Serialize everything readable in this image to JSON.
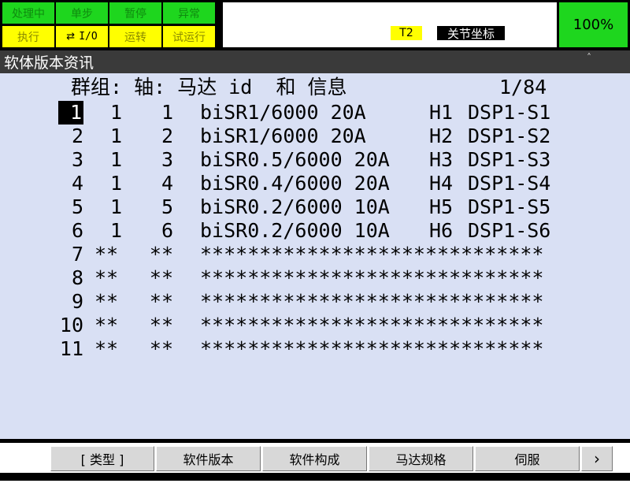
{
  "status_lamps": {
    "row1": [
      "处理中",
      "单步",
      "暂停",
      "异常"
    ],
    "row2": [
      "执行",
      "I/O",
      "运转",
      "试运行"
    ]
  },
  "status": {
    "mode": "T2",
    "coord": "关节坐标",
    "override": "100%"
  },
  "screen_title": "软体版本资讯",
  "table": {
    "header": "群组: 轴: 马达 id  和 信息",
    "page": "1/84",
    "rows": [
      {
        "no": "1",
        "group": "1",
        "axis": "1",
        "motor": "biSR1/6000 20A",
        "hw": "H1",
        "dsp": "DSP1-S1"
      },
      {
        "no": "2",
        "group": "1",
        "axis": "2",
        "motor": "biSR1/6000 20A",
        "hw": "H2",
        "dsp": "DSP1-S2"
      },
      {
        "no": "3",
        "group": "1",
        "axis": "3",
        "motor": "biSR0.5/6000 20A",
        "hw": "H3",
        "dsp": "DSP1-S3"
      },
      {
        "no": "4",
        "group": "1",
        "axis": "4",
        "motor": "biSR0.4/6000 20A",
        "hw": "H4",
        "dsp": "DSP1-S4"
      },
      {
        "no": "5",
        "group": "1",
        "axis": "5",
        "motor": "biSR0.2/6000 10A",
        "hw": "H5",
        "dsp": "DSP1-S5"
      },
      {
        "no": "6",
        "group": "1",
        "axis": "6",
        "motor": "biSR0.2/6000 10A",
        "hw": "H6",
        "dsp": "DSP1-S6"
      },
      {
        "no": "7",
        "group": "**",
        "axis": "**",
        "motor": "*****************************",
        "hw": "",
        "dsp": ""
      },
      {
        "no": "8",
        "group": "**",
        "axis": "**",
        "motor": "*****************************",
        "hw": "",
        "dsp": ""
      },
      {
        "no": "9",
        "group": "**",
        "axis": "**",
        "motor": "*****************************",
        "hw": "",
        "dsp": ""
      },
      {
        "no": "10",
        "group": "**",
        "axis": "**",
        "motor": "*****************************",
        "hw": "",
        "dsp": ""
      },
      {
        "no": "11",
        "group": "**",
        "axis": "**",
        "motor": "*****************************",
        "hw": "",
        "dsp": ""
      }
    ]
  },
  "softkeys": [
    "[ 类型 ]",
    "软件版本",
    "软件构成",
    "马达规格",
    "伺服",
    "›"
  ],
  "colors": {
    "lamp_green": "#1ed61e",
    "lamp_yellow": "#ffff00",
    "content_bg": "#d9e0f4",
    "title_bg": "#3a3a3a"
  }
}
